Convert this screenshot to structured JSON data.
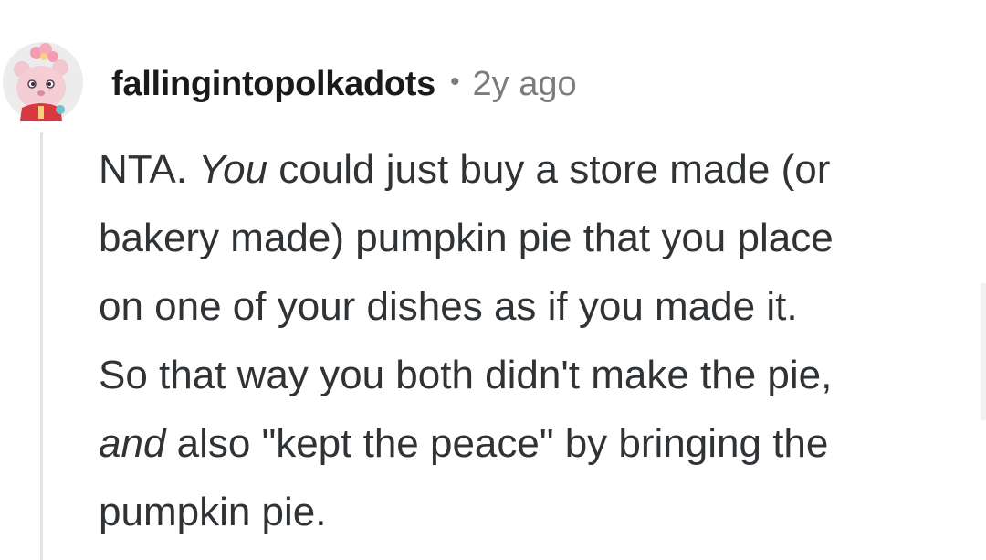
{
  "comment": {
    "author": "fallingintopolkadots",
    "separator": "•",
    "age": "2y ago",
    "avatar": {
      "icon": "snoo-avatar-icon",
      "colors": {
        "face": "#f2c6cf",
        "bow": "#f39bb1",
        "bg": "#e9e9e9"
      }
    },
    "body_lines": [
      [
        "",
        "NTA. ",
        "You",
        " could just buy a store made (or"
      ],
      [
        "",
        "bakery made) pumpkin pie that you place",
        "",
        ""
      ],
      [
        "",
        "on one of your dishes as if you made it.",
        "",
        ""
      ],
      [
        "",
        "So that way you both didn't make the pie,",
        "",
        ""
      ],
      [
        "and",
        " also \"kept the peace\" by bringing the",
        "",
        ""
      ],
      [
        "",
        "pumpkin pie.",
        "",
        ""
      ]
    ]
  },
  "colors": {
    "thread_line": "#e3e3e3",
    "meta_text": "#7c7c7c",
    "body_text": "#303336"
  }
}
